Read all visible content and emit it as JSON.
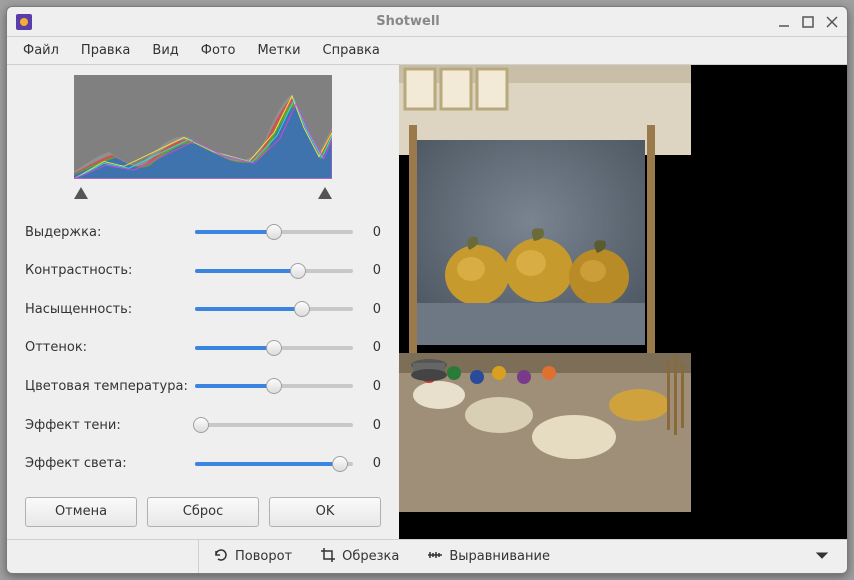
{
  "window": {
    "title": "Shotwell"
  },
  "menubar": [
    "Файл",
    "Правка",
    "Вид",
    "Фото",
    "Метки",
    "Справка"
  ],
  "sliders": [
    {
      "label": "Выдержка:",
      "value": 0,
      "fill_pct": 50,
      "thumb_pct": 50
    },
    {
      "label": "Контрастность:",
      "value": 0,
      "fill_pct": 65,
      "thumb_pct": 65
    },
    {
      "label": "Насыщенность:",
      "value": 0,
      "fill_pct": 68,
      "thumb_pct": 68
    },
    {
      "label": "Оттенок:",
      "value": 0,
      "fill_pct": 50,
      "thumb_pct": 50
    },
    {
      "label": "Цветовая температура:",
      "value": 0,
      "fill_pct": 50,
      "thumb_pct": 50
    },
    {
      "label": "Эффект тени:",
      "value": 0,
      "fill_pct": 0,
      "thumb_pct": 4
    },
    {
      "label": "Эффект света:",
      "value": 0,
      "fill_pct": 92,
      "thumb_pct": 92
    }
  ],
  "buttons": {
    "cancel": "Отмена",
    "reset": "Сброс",
    "ok": "OK"
  },
  "bottombar": {
    "rotate": "Поворот",
    "crop": "Обрезка",
    "straighten": "Выравнивание"
  }
}
